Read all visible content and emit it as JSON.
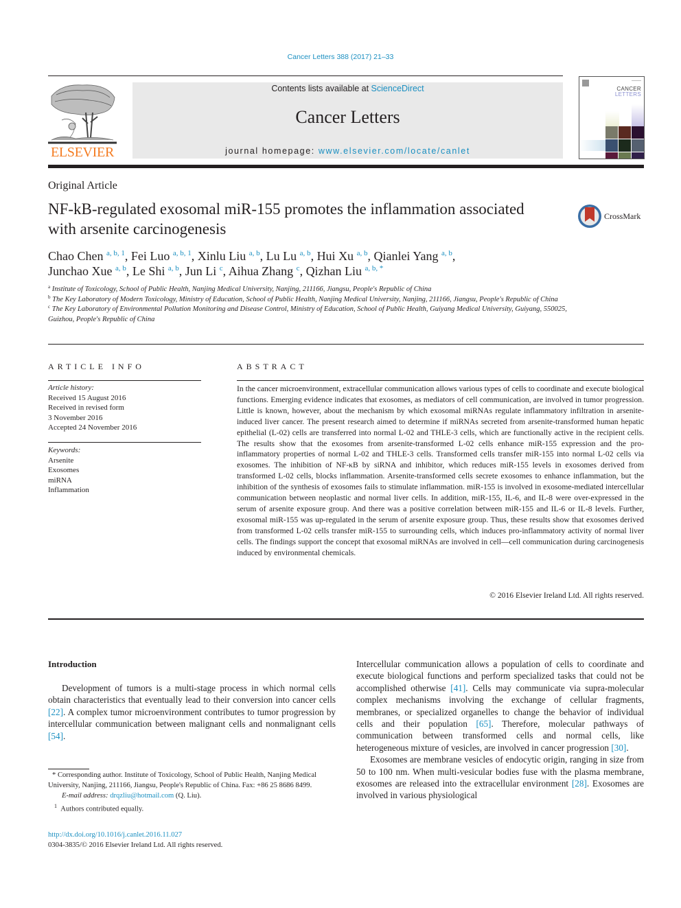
{
  "running_head": "Cancer Letters 388 (2017) 21–33",
  "publisher": {
    "name": "ELSEVIER",
    "brand_color": "#f47b20"
  },
  "banner": {
    "contents_prefix": "Contents lists available at ",
    "contents_link": "ScienceDirect",
    "journal_title": "Cancer Letters",
    "homepage_prefix": "journal homepage: ",
    "homepage_link": "www.elsevier.com/locate/canlet"
  },
  "cover": {
    "title_line1": "CANCER",
    "title_line2": "LETTERS"
  },
  "article": {
    "type": "Original Article",
    "title": "NF-kB-regulated exosomal miR-155 promotes the inflammation associated with arsenite carcinogenesis",
    "crossmark_label": "CrossMark",
    "authors": [
      {
        "name": "Chao Chen",
        "sup": "a, b, 1"
      },
      {
        "name": "Fei Luo",
        "sup": "a, b, 1"
      },
      {
        "name": "Xinlu Liu",
        "sup": "a, b"
      },
      {
        "name": "Lu Lu",
        "sup": "a, b"
      },
      {
        "name": "Hui Xu",
        "sup": "a, b"
      },
      {
        "name": "Qianlei Yang",
        "sup": "a, b"
      },
      {
        "name": "Junchao Xue",
        "sup": "a, b"
      },
      {
        "name": "Le Shi",
        "sup": "a, b"
      },
      {
        "name": "Jun Li",
        "sup": "c"
      },
      {
        "name": "Aihua Zhang",
        "sup": "c"
      },
      {
        "name": "Qizhan Liu",
        "sup": "a, b, *"
      }
    ],
    "affiliations": [
      {
        "key": "a",
        "text": "Institute of Toxicology, School of Public Health, Nanjing Medical University, Nanjing, 211166, Jiangsu, People's Republic of China"
      },
      {
        "key": "b",
        "text": "The Key Laboratory of Modern Toxicology, Ministry of Education, School of Public Health, Nanjing Medical University, Nanjing, 211166, Jiangsu, People's Republic of China"
      },
      {
        "key": "c",
        "text": "The Key Laboratory of Environmental Pollution Monitoring and Disease Control, Ministry of Education, School of Public Health, Guiyang Medical University, Guiyang, 550025, Guizhou, People's Republic of China"
      }
    ]
  },
  "article_info": {
    "heading": "ARTICLE INFO",
    "history_label": "Article history:",
    "history": [
      "Received 15 August 2016",
      "Received in revised form",
      "3 November 2016",
      "Accepted 24 November 2016"
    ],
    "keywords_label": "Keywords:",
    "keywords": [
      "Arsenite",
      "Exosomes",
      "miRNA",
      "Inflammation"
    ]
  },
  "abstract": {
    "heading": "ABSTRACT",
    "text": "In the cancer microenvironment, extracellular communication allows various types of cells to coordinate and execute biological functions. Emerging evidence indicates that exosomes, as mediators of cell communication, are involved in tumor progression. Little is known, however, about the mechanism by which exosomal miRNAs regulate inflammatory infiltration in arsenite-induced liver cancer. The present research aimed to determine if miRNAs secreted from arsenite-transformed human hepatic epithelial (L-02) cells are transferred into normal L-02 and THLE-3 cells, which are functionally active in the recipient cells. The results show that the exosomes from arsenite-transformed L-02 cells enhance miR-155 expression and the pro-inflammatory properties of normal L-02 and THLE-3 cells. Transformed cells transfer miR-155 into normal L-02 cells via exosomes. The inhibition of NF-κB by siRNA and inhibitor, which reduces miR-155 levels in exosomes derived from transformed L-02 cells, blocks inflammation. Arsenite-transformed cells secrete exosomes to enhance inflammation, but the inhibition of the syn­thesis of exosomes fails to stimulate inflammation. miR-155 is involved in exosome-mediated intercel­lular communication between neoplastic and normal liver cells. In addition, miR-155, IL-6, and IL-8 were over-expressed in the serum of arsenite exposure group. And there was a positive correlation between miR-155 and IL-6 or IL-8 levels. Further, exosomal miR-155 was up-regulated in the serum of arsenite exposure group. Thus, these results show that exosomes derived from transformed L-02 cells transfer miR-155 to surrounding cells, which induces pro-inflammatory activity of normal liver cells. The findings support the concept that exosomal miRNAs are involved in cell—cell communication during carcino­genesis induced by environmental chemicals.",
    "copyright": "© 2016 Elsevier Ireland Ltd. All rights reserved."
  },
  "body": {
    "intro_heading": "Introduction",
    "left_paragraph": [
      {
        "text": "Development of tumors is a multi-stage process in which normal cells obtain characteristics that eventually lead to their conversion into cancer cells "
      },
      {
        "ref": "[22]"
      },
      {
        "text": ". A complex tumor microenviron­ment contributes to tumor progression by intercellular communi­cation between malignant cells and nonmalignant cells "
      },
      {
        "ref": "[54]"
      },
      {
        "text": "."
      }
    ],
    "right_paragraph_1": [
      {
        "text": "Intercellular communication allows a population of cells to coor­dinate and execute biological functions and perform specialized tasks that could not be accomplished otherwise "
      },
      {
        "ref": "[41]"
      },
      {
        "text": ". Cells may communicate via supra-molecular complex mechanisms involving the exchange of cellular fragments, membranes, or specialized or­ganelles to change the behavior of individual cells and their pop­ulation "
      },
      {
        "ref": "[65]"
      },
      {
        "text": ". Therefore, molecular pathways of communication between transformed cells and normal cells, like heterogeneous mixture of vesicles, are involved in cancer progression "
      },
      {
        "ref": "[30]"
      },
      {
        "text": "."
      }
    ],
    "right_paragraph_2": [
      {
        "text": "Exosomes are membrane vesicles of endocytic origin, ranging in size from 50 to 100 nm. When multi-vesicular bodies fuse with the plasma membrane, exosomes are released into the extracellular environment "
      },
      {
        "ref": "[28]"
      },
      {
        "text": ". Exosomes are involved in various physiological"
      }
    ]
  },
  "footnotes": {
    "corresponding": "* Corresponding author. Institute of Toxicology, School of Public Health, Nanjing Medical University, Nanjing, 211166, Jiangsu, People's Republic of China. Fax: +86 25 8686 8499.",
    "email_label": "E-mail address: ",
    "email": "drqzliu@hotmail.com",
    "email_suffix": " (Q. Liu).",
    "equal_contrib_mark": "1",
    "equal_contrib": "Authors contributed equally."
  },
  "doi": "http://dx.doi.org/10.1016/j.canlet.2016.11.027",
  "issn_line": "0304-3835/© 2016 Elsevier Ireland Ltd. All rights reserved.",
  "colors": {
    "link": "#1a8fc1",
    "banner_bg": "#e9e9e9",
    "text": "#231f20"
  }
}
